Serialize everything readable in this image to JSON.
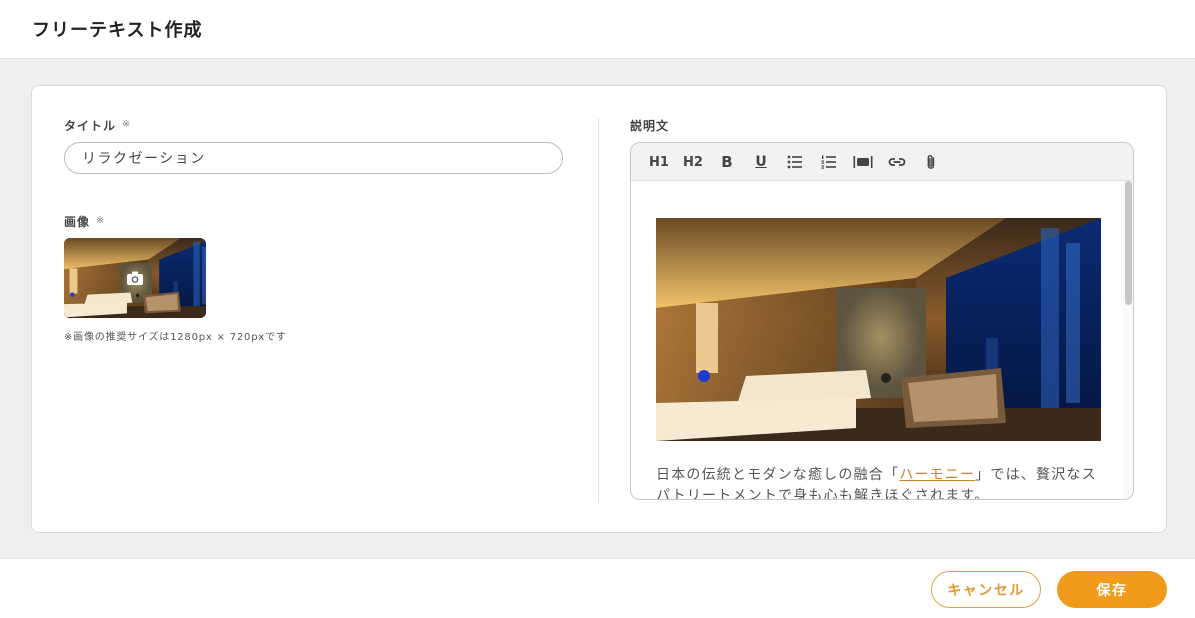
{
  "header": {
    "title": "フリーテキスト作成"
  },
  "form": {
    "title_field": {
      "label": "タイトル",
      "required_mark": "※",
      "value": "リラクゼーション"
    },
    "image_field": {
      "label": "画像",
      "required_mark": "※",
      "note": "※画像の推奨サイズは1280px × 720pxです"
    },
    "description_field": {
      "label": "説明文",
      "toolbar": {
        "h1": "H1",
        "h2": "H2",
        "bold": "B",
        "underline": "U"
      },
      "text_before_link": "日本の伝統とモダンな癒しの融合「",
      "link_text": "ハーモニー",
      "text_after_link": "」では、贅沢なスパトリートメントで身も心も解きほぐされます。"
    }
  },
  "footer": {
    "cancel_label": "キャンセル",
    "save_label": "保存"
  },
  "colors": {
    "accent": "#f19a1b",
    "link": "#c9822a"
  }
}
